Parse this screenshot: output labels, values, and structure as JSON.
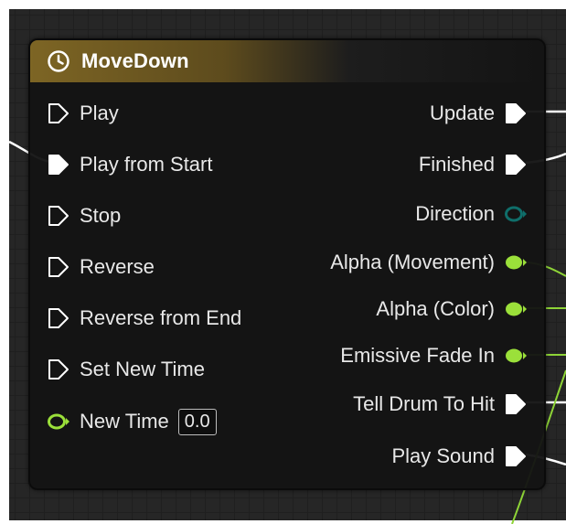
{
  "node": {
    "title": "MoveDown",
    "header_icon": "clock-icon",
    "header_color": "#7d6524"
  },
  "inputs": [
    {
      "label": "Play",
      "pin": "exec-outline"
    },
    {
      "label": "Play from Start",
      "pin": "exec-filled"
    },
    {
      "label": "Stop",
      "pin": "exec-outline"
    },
    {
      "label": "Reverse",
      "pin": "exec-outline"
    },
    {
      "label": "Reverse from End",
      "pin": "exec-outline"
    },
    {
      "label": "Set New Time",
      "pin": "exec-outline"
    },
    {
      "label": "New Time",
      "pin": "float-outline",
      "value": "0.0"
    }
  ],
  "outputs": [
    {
      "label": "Update",
      "pin": "exec-filled"
    },
    {
      "label": "Finished",
      "pin": "exec-filled"
    },
    {
      "label": "Direction",
      "pin": "enum-outline"
    },
    {
      "label": "Alpha (Movement)",
      "pin": "float-filled"
    },
    {
      "label": "Alpha (Color)",
      "pin": "float-filled"
    },
    {
      "label": "Emissive Fade In",
      "pin": "float-filled"
    },
    {
      "label": "Tell Drum To Hit",
      "pin": "exec-filled"
    },
    {
      "label": "Play Sound",
      "pin": "exec-filled"
    }
  ],
  "colors": {
    "exec": "#ffffff",
    "float": "#9be03a",
    "enum": "#0f6e6a",
    "wire_exec": "#ffffff",
    "wire_float": "#8ed437"
  }
}
